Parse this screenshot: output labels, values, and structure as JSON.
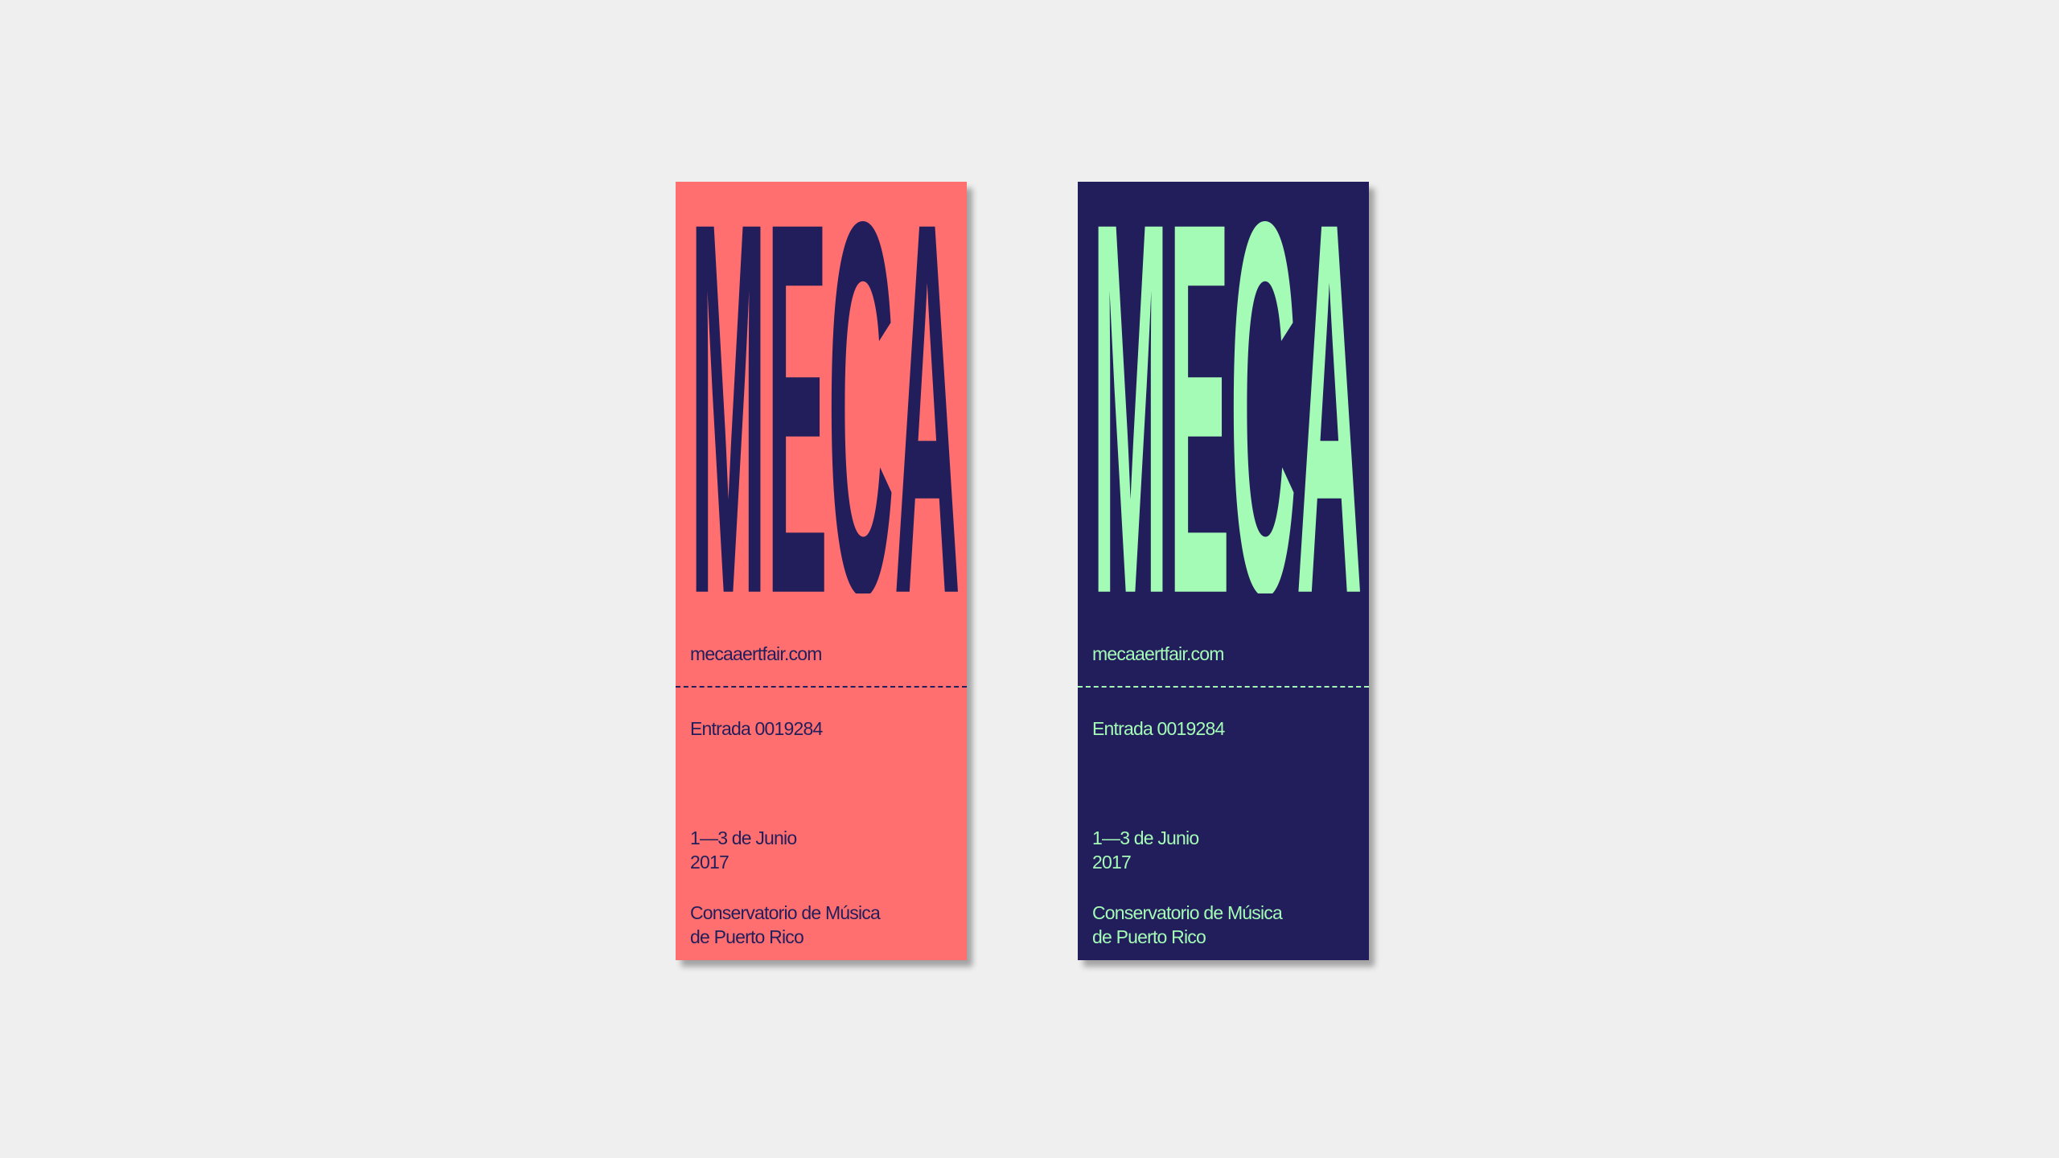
{
  "tickets": [
    {
      "id": "coral",
      "colors": {
        "background": "#ff6f6f",
        "text": "#221e5b",
        "perforation": "#221e5b"
      },
      "wordmark": "MECA",
      "website": "mecaaertfair.com",
      "entry": "Entrada 0019284",
      "date_line1": "1—3 de Junio",
      "date_line2": "2017",
      "venue_line1": "Conservatorio de Música",
      "venue_line2": "de Puerto Rico"
    },
    {
      "id": "navy",
      "colors": {
        "background": "#221e5b",
        "text": "#a4fbb6",
        "perforation": "#a4fbb6"
      },
      "wordmark": "MECA",
      "website": "mecaaertfair.com",
      "entry": "Entrada 0019284",
      "date_line1": "1—3 de Junio",
      "date_line2": "2017",
      "venue_line1": "Conservatorio de Música",
      "venue_line2": "de Puerto Rico"
    }
  ],
  "background_color": "#efefef"
}
